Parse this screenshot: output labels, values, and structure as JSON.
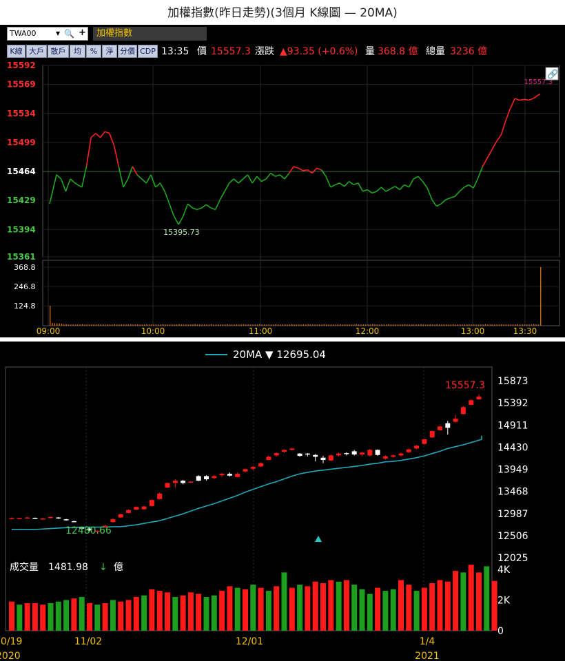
{
  "title": "加權指數(昨日走勢)(3個月 K線圖 — 20MA)",
  "toolbar": {
    "code": "TWA00",
    "index_name": "加權指數",
    "buttons": [
      "K線",
      "大戶",
      "散戶",
      "均",
      "%",
      "淨",
      "分價",
      "CDP"
    ],
    "time": "13:35",
    "price_label": "價",
    "price": "15557.3",
    "change_label": "漲跌",
    "change": "▲93.35 (+0.6%)",
    "volume_label": "量",
    "volume": "368.8 億",
    "total_label": "總量",
    "total": "3236 億"
  },
  "colors": {
    "up": "#ff2020",
    "down": "#1ea81e",
    "ma": "#20a8b8",
    "volume": "#d06a10",
    "text_green": "#48c848"
  },
  "chart_data": [
    {
      "type": "line",
      "title": "intraday",
      "x_ticks": [
        "09:00",
        "10:00",
        "11:00",
        "12:00",
        "13:00",
        "13:30"
      ],
      "y_ticks": [
        15592,
        15569,
        15534,
        15499,
        15464,
        15429,
        15394,
        15361
      ],
      "ylim": [
        15361,
        15592
      ],
      "reference": 15464,
      "annotations": {
        "high": "15557.3",
        "low": "15395.73"
      },
      "price": [
        [
          0,
          15425
        ],
        [
          3,
          15460
        ],
        [
          5,
          15455
        ],
        [
          7,
          15440
        ],
        [
          9,
          15455
        ],
        [
          11,
          15450
        ],
        [
          14,
          15445
        ],
        [
          16,
          15470
        ],
        [
          18,
          15505
        ],
        [
          20,
          15510
        ],
        [
          22,
          15505
        ],
        [
          24,
          15512
        ],
        [
          26,
          15510
        ],
        [
          28,
          15495
        ],
        [
          30,
          15470
        ],
        [
          32,
          15445
        ],
        [
          34,
          15455
        ],
        [
          36,
          15470
        ],
        [
          38,
          15460
        ],
        [
          40,
          15455
        ],
        [
          42,
          15450
        ],
        [
          44,
          15460
        ],
        [
          46,
          15445
        ],
        [
          48,
          15450
        ],
        [
          50,
          15440
        ],
        [
          52,
          15425
        ],
        [
          54,
          15410
        ],
        [
          56,
          15400
        ],
        [
          58,
          15410
        ],
        [
          60,
          15425
        ],
        [
          62,
          15420
        ],
        [
          64,
          15418
        ],
        [
          66,
          15420
        ],
        [
          68,
          15424
        ],
        [
          70,
          15420
        ],
        [
          72,
          15418
        ],
        [
          74,
          15430
        ],
        [
          76,
          15440
        ],
        [
          78,
          15450
        ],
        [
          80,
          15455
        ],
        [
          82,
          15450
        ],
        [
          84,
          15455
        ],
        [
          86,
          15460
        ],
        [
          88,
          15450
        ],
        [
          90,
          15458
        ],
        [
          92,
          15452
        ],
        [
          94,
          15455
        ],
        [
          96,
          15462
        ],
        [
          98,
          15458
        ],
        [
          100,
          15460
        ],
        [
          102,
          15455
        ],
        [
          104,
          15462
        ],
        [
          106,
          15470
        ],
        [
          108,
          15468
        ],
        [
          110,
          15465
        ],
        [
          112,
          15466
        ],
        [
          114,
          15462
        ],
        [
          116,
          15468
        ],
        [
          118,
          15466
        ],
        [
          120,
          15458
        ],
        [
          122,
          15445
        ],
        [
          124,
          15448
        ],
        [
          126,
          15450
        ],
        [
          128,
          15446
        ],
        [
          130,
          15452
        ],
        [
          132,
          15448
        ],
        [
          134,
          15450
        ],
        [
          136,
          15440
        ],
        [
          138,
          15442
        ],
        [
          140,
          15438
        ],
        [
          142,
          15440
        ],
        [
          144,
          15445
        ],
        [
          146,
          15440
        ],
        [
          148,
          15443
        ],
        [
          150,
          15446
        ],
        [
          152,
          15442
        ],
        [
          154,
          15448
        ],
        [
          156,
          15445
        ],
        [
          158,
          15455
        ],
        [
          160,
          15458
        ],
        [
          162,
          15452
        ],
        [
          164,
          15444
        ],
        [
          166,
          15430
        ],
        [
          168,
          15422
        ],
        [
          170,
          15425
        ],
        [
          172,
          15430
        ],
        [
          174,
          15432
        ],
        [
          176,
          15434
        ],
        [
          178,
          15440
        ],
        [
          180,
          15445
        ],
        [
          182,
          15448
        ],
        [
          184,
          15444
        ],
        [
          186,
          15456
        ],
        [
          188,
          15470
        ],
        [
          190,
          15480
        ],
        [
          192,
          15490
        ],
        [
          194,
          15500
        ],
        [
          196,
          15508
        ],
        [
          198,
          15525
        ],
        [
          200,
          15540
        ],
        [
          202,
          15552
        ],
        [
          204,
          15550
        ],
        [
          206,
          15551
        ],
        [
          208,
          15550
        ],
        [
          210,
          15552
        ],
        [
          212,
          15556
        ],
        [
          213,
          15557.3
        ]
      ],
      "volume": [
        [
          0,
          124.8
        ],
        [
          1,
          20
        ],
        [
          4,
          14
        ],
        [
          8,
          13
        ],
        [
          20,
          10
        ],
        [
          40,
          9
        ],
        [
          80,
          8
        ],
        [
          120,
          8
        ],
        [
          160,
          8
        ],
        [
          200,
          8
        ],
        [
          212,
          10
        ],
        [
          213,
          368.8
        ]
      ],
      "volume_ticks": [
        368.8,
        246.8,
        124.8
      ]
    },
    {
      "type": "candlestick",
      "legend": "20MA ▼ 12695.04",
      "last_label": "15557.3",
      "low_label": "12480.66",
      "y_ticks": [
        15873,
        15392,
        14911,
        14430,
        13949,
        13468,
        12987,
        12506,
        12025
      ],
      "ylim": [
        12025,
        15873
      ],
      "x_labels": [
        {
          "label": "10/19",
          "sub": "2020"
        },
        {
          "label": "11/02",
          "sub": ""
        },
        {
          "label": "12/01",
          "sub": ""
        },
        {
          "label": "1/4",
          "sub": "2021"
        }
      ],
      "volume_label": "成交量",
      "volume_value": "1481.98",
      "volume_arrow": "↓",
      "volume_unit": "億",
      "volume_ticks": [
        "4K",
        "2K",
        "0"
      ],
      "candles": [
        [
          12880,
          12890,
          12860,
          12900
        ],
        [
          12880,
          12885,
          12870,
          12890
        ],
        [
          12890,
          12900,
          12880,
          12910
        ],
        [
          12890,
          12880,
          12870,
          12900
        ],
        [
          12880,
          12880,
          12860,
          12890
        ],
        [
          12890,
          12910,
          12880,
          12920
        ],
        [
          12900,
          12880,
          12870,
          12910
        ],
        [
          12860,
          12840,
          12830,
          12870
        ],
        [
          12820,
          12810,
          12800,
          12830
        ],
        [
          12680,
          12660,
          12640,
          12700
        ],
        [
          12660,
          12620,
          12600,
          12680
        ],
        [
          12590,
          12610,
          12560,
          12620
        ],
        [
          12690,
          12720,
          12680,
          12740
        ],
        [
          12800,
          12860,
          12790,
          12880
        ],
        [
          12900,
          12970,
          12890,
          12980
        ],
        [
          13000,
          13060,
          12990,
          13080
        ],
        [
          13070,
          13130,
          13060,
          13140
        ],
        [
          13080,
          13140,
          13070,
          13150
        ],
        [
          13150,
          13280,
          13140,
          13290
        ],
        [
          13300,
          13420,
          13290,
          13440
        ],
        [
          13550,
          13650,
          13540,
          13660
        ],
        [
          13650,
          13700,
          13550,
          13730
        ],
        [
          13700,
          13650,
          13620,
          13720
        ],
        [
          13670,
          13680,
          13650,
          13690
        ],
        [
          13800,
          13700,
          13690,
          13820
        ],
        [
          13800,
          13730,
          13700,
          13820
        ],
        [
          13760,
          13800,
          13730,
          13820
        ],
        [
          13820,
          13850,
          13780,
          13870
        ],
        [
          13850,
          13810,
          13790,
          13880
        ],
        [
          13780,
          13850,
          13770,
          13880
        ],
        [
          13900,
          13950,
          13880,
          13960
        ],
        [
          13960,
          14000,
          13930,
          14020
        ],
        [
          14010,
          14080,
          14000,
          14100
        ],
        [
          14150,
          14220,
          14140,
          14250
        ],
        [
          14250,
          14300,
          14220,
          14320
        ],
        [
          14330,
          14370,
          14310,
          14380
        ],
        [
          14370,
          14400,
          14350,
          14410
        ],
        [
          14290,
          14240,
          14220,
          14300
        ],
        [
          14290,
          14270,
          14230,
          14300
        ],
        [
          14260,
          14220,
          14120,
          14280
        ],
        [
          14200,
          14150,
          14080,
          14240
        ],
        [
          14140,
          14250,
          14120,
          14270
        ],
        [
          14250,
          14290,
          14230,
          14310
        ],
        [
          14300,
          14280,
          14250,
          14320
        ],
        [
          14340,
          14270,
          14250,
          14370
        ],
        [
          14270,
          14310,
          14240,
          14330
        ],
        [
          14250,
          14370,
          14230,
          14390
        ],
        [
          14370,
          14260,
          14240,
          14380
        ],
        [
          14180,
          14230,
          14160,
          14250
        ],
        [
          14220,
          14250,
          14200,
          14270
        ],
        [
          14250,
          14290,
          14230,
          14310
        ],
        [
          14320,
          14380,
          14300,
          14400
        ],
        [
          14400,
          14460,
          14380,
          14480
        ],
        [
          14500,
          14600,
          14480,
          14620
        ],
        [
          14640,
          14780,
          14630,
          14790
        ],
        [
          14800,
          14880,
          14790,
          14890
        ],
        [
          14950,
          14850,
          14700,
          15000
        ],
        [
          14980,
          15050,
          14960,
          15130
        ],
        [
          15150,
          15300,
          15140,
          15320
        ],
        [
          15350,
          15450,
          15340,
          15470
        ],
        [
          15470,
          15530,
          15460,
          15580
        ]
      ],
      "ma20": [
        12640,
        12640,
        12640,
        12640,
        12650,
        12660,
        12670,
        12680,
        12680,
        12690,
        12690,
        12690,
        12690,
        12700,
        12700,
        12720,
        12740,
        12770,
        12800,
        12830,
        12880,
        12930,
        12980,
        13040,
        13100,
        13150,
        13200,
        13260,
        13320,
        13380,
        13450,
        13510,
        13570,
        13630,
        13680,
        13740,
        13800,
        13850,
        13880,
        13910,
        13930,
        13950,
        13970,
        13990,
        14010,
        14030,
        14060,
        14080,
        14110,
        14120,
        14140,
        14170,
        14200,
        14240,
        14290,
        14340,
        14400,
        14440,
        14480,
        14530,
        14580,
        14600,
        14680
      ],
      "ma_last": 14680,
      "volumes": [
        1900,
        1700,
        1800,
        1800,
        1700,
        1800,
        1900,
        2000,
        2100,
        2200,
        1800,
        1700,
        1800,
        2000,
        1900,
        2000,
        2200,
        2300,
        2700,
        2600,
        2500,
        2200,
        2300,
        2500,
        2400,
        2200,
        2300,
        2600,
        2900,
        2800,
        2700,
        3000,
        2800,
        2600,
        2900,
        3800,
        2800,
        3000,
        2900,
        3200,
        3100,
        3300,
        3200,
        3300,
        3000,
        2700,
        2400,
        2800,
        2600,
        2700,
        3300,
        3000,
        2600,
        2800,
        3100,
        3300,
        3200,
        3900,
        3800,
        4300,
        3800,
        4200,
        3250
      ],
      "vol_up": [
        1,
        0,
        1,
        1,
        1,
        0,
        0,
        0,
        1,
        0,
        1,
        0,
        1,
        0,
        1,
        1,
        1,
        0,
        1,
        1,
        1,
        0,
        1,
        1,
        1,
        0,
        0,
        1,
        1,
        0,
        1,
        0,
        1,
        0,
        1,
        0,
        1,
        0,
        1,
        1,
        1,
        1,
        0,
        1,
        0,
        0,
        0,
        1,
        0,
        0,
        1,
        1,
        0,
        1,
        1,
        1,
        1,
        1,
        0,
        1,
        1,
        0,
        1
      ],
      "vol_max": 4400
    }
  ]
}
